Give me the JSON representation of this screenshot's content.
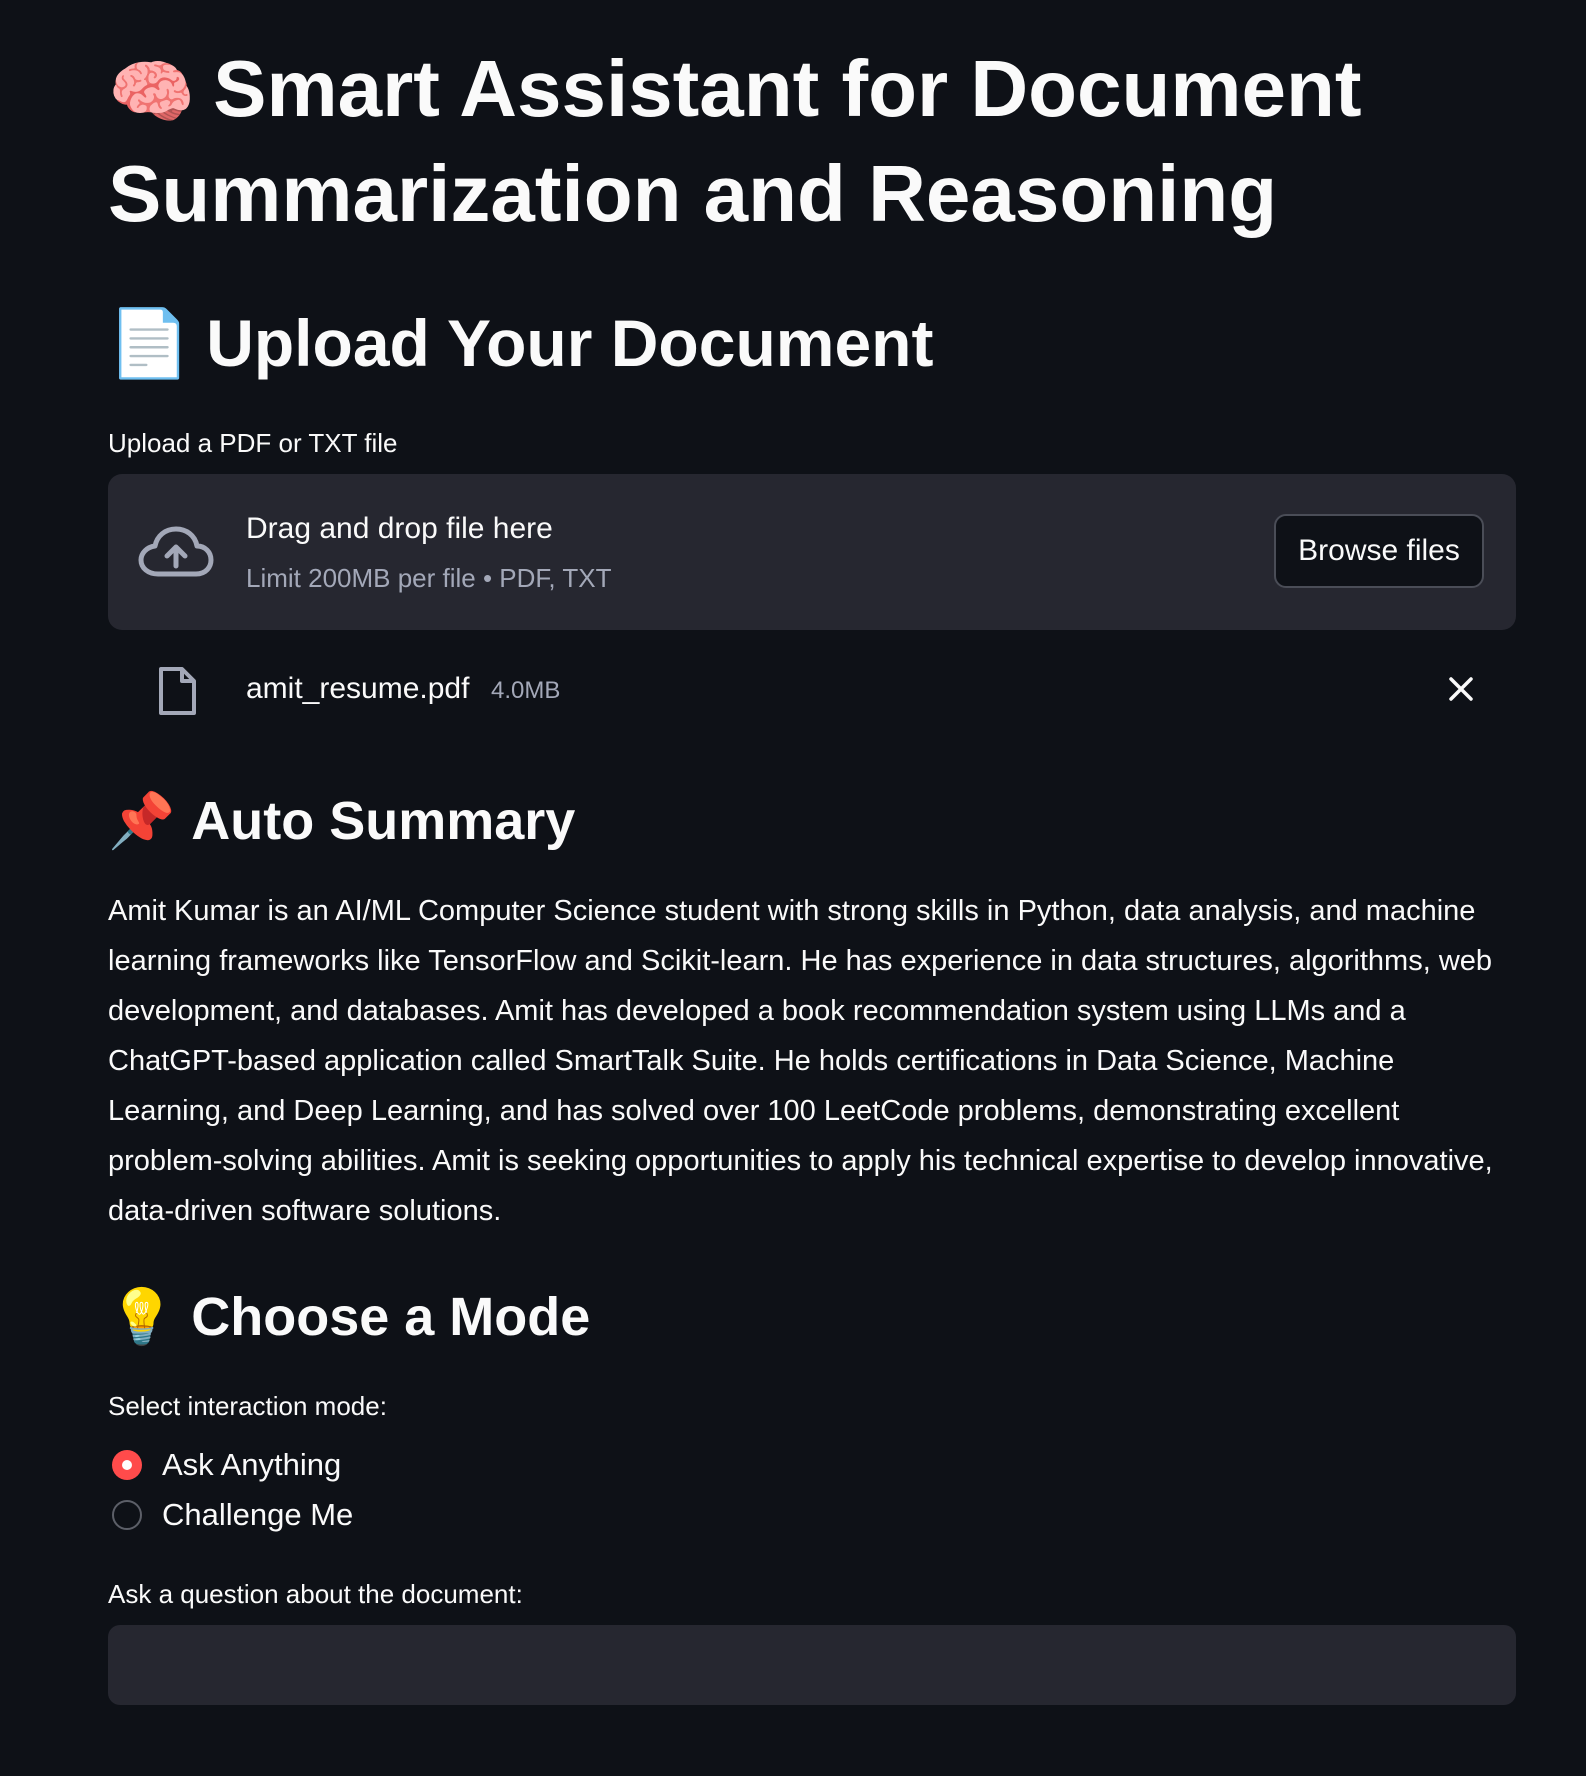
{
  "title": {
    "emoji": "🧠",
    "text": "Smart Assistant for Document Summarization and Reasoning"
  },
  "upload_section": {
    "emoji": "📄",
    "heading": "Upload Your Document",
    "label": "Upload a PDF or TXT file",
    "dropzone": {
      "icon": "cloud-upload-icon",
      "title": "Drag and drop file here",
      "subtitle": "Limit 200MB per file • PDF, TXT",
      "browse_label": "Browse files"
    },
    "file": {
      "icon": "file-icon",
      "name": "amit_resume.pdf",
      "size": "4.0MB",
      "remove_icon": "close-icon"
    }
  },
  "summary_section": {
    "emoji": "📌",
    "heading": "Auto Summary",
    "text": "Amit Kumar is an AI/ML Computer Science student with strong skills in Python, data analysis, and machine learning frameworks like TensorFlow and Scikit-learn. He has experience in data structures, algorithms, web development, and databases. Amit has developed a book recommendation system using LLMs and a ChatGPT-based application called SmartTalk Suite. He holds certifications in Data Science, Machine Learning, and Deep Learning, and has solved over 100 LeetCode problems, demonstrating excellent problem-solving abilities. Amit is seeking opportunities to apply his technical expertise to develop innovative, data-driven software solutions."
  },
  "mode_section": {
    "emoji": "💡",
    "heading": "Choose a Mode",
    "label": "Select interaction mode:",
    "options": [
      {
        "label": "Ask Anything",
        "selected": true
      },
      {
        "label": "Challenge Me",
        "selected": false
      }
    ]
  },
  "question": {
    "label": "Ask a question about the document:",
    "value": ""
  },
  "colors": {
    "background": "#0e1117",
    "panel": "#262730",
    "accent": "#ff4b4b",
    "muted_text": "#a3a8b8"
  }
}
